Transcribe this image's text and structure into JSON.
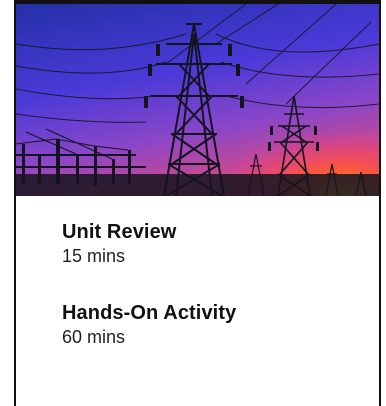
{
  "hero": {
    "image_name": "power-transmission-towers-sunset-image",
    "colors": {
      "sky_top": "#2a2fb8",
      "sky_mid": "#6a3fd0",
      "sky_low": "#c04aa0",
      "horizon": "#ff6a2a",
      "silhouette": "#141420"
    }
  },
  "activities": [
    {
      "title": "Unit Review",
      "duration": "15 mins"
    },
    {
      "title": "Hands-On Activity",
      "duration": "60 mins"
    }
  ]
}
